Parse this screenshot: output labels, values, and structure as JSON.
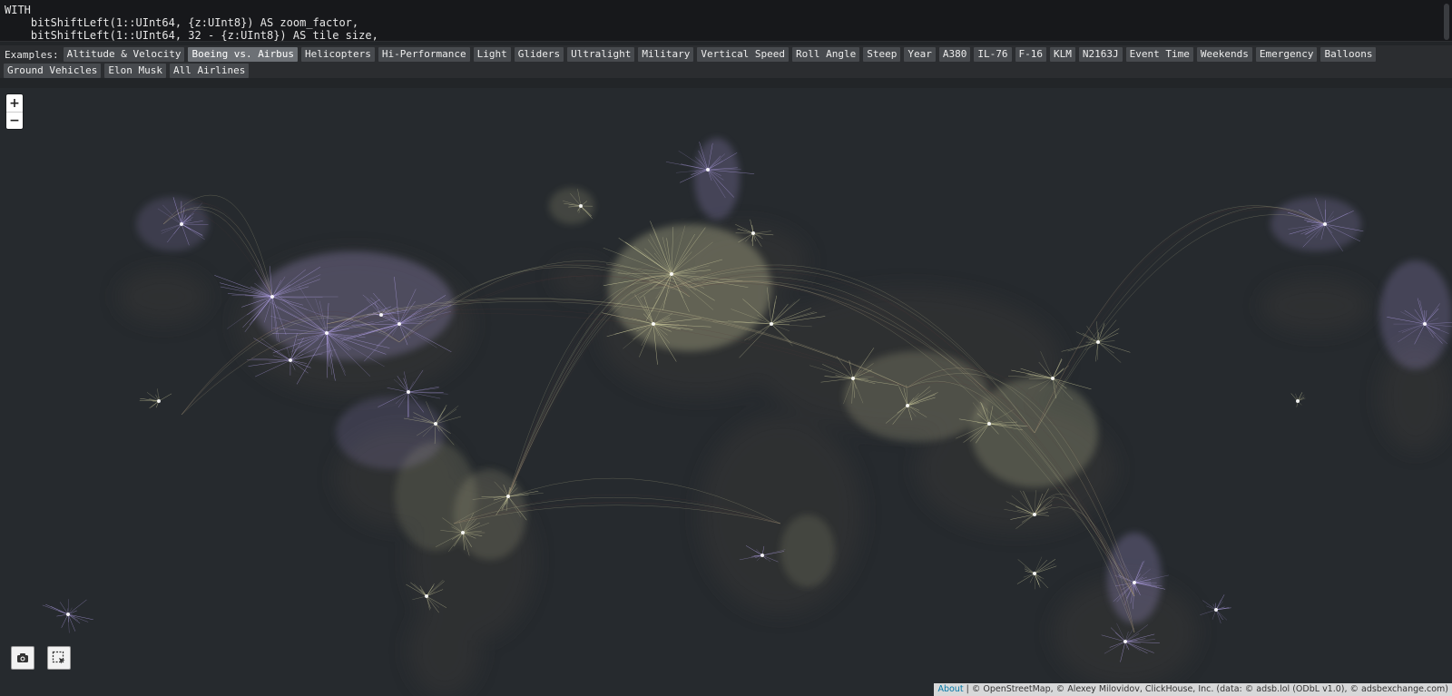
{
  "query": {
    "lines": [
      "WITH",
      "    bitShiftLeft(1::UInt64, {z:UInt8}) AS zoom_factor,",
      "    bitShiftLeft(1::UInt64, 32 - {z:UInt8}) AS tile_size,"
    ]
  },
  "examples": {
    "label": "Examples:",
    "active_index": 1,
    "items": [
      "Altitude & Velocity",
      "Boeing vs. Airbus",
      "Helicopters",
      "Hi-Performance",
      "Light",
      "Gliders",
      "Ultralight",
      "Military",
      "Vertical Speed",
      "Roll Angle",
      "Steep",
      "Year",
      "A380",
      "IL-76",
      "F-16",
      "KLM",
      "N2163J",
      "Event Time",
      "Weekends",
      "Emergency",
      "Balloons",
      "Ground Vehicles",
      "Elon Musk",
      "All Airlines"
    ]
  },
  "map": {
    "zoom_in": "+",
    "zoom_out": "−",
    "colors": {
      "background": "#262a2e",
      "boeing": "#e8e6b0",
      "airbus": "#c4b0ff",
      "dark_traffic": "#5a3a3a"
    }
  },
  "tools": {
    "left_icon": "camera-icon",
    "right_icon": "select-box-icon"
  },
  "attribution": {
    "about": "About",
    "text": "© OpenStreetMap, © Alexey Milovidov, ClickHouse, Inc. (data: © adsb.lol (ODbL v1.0), © adsbexchange.com)"
  }
}
